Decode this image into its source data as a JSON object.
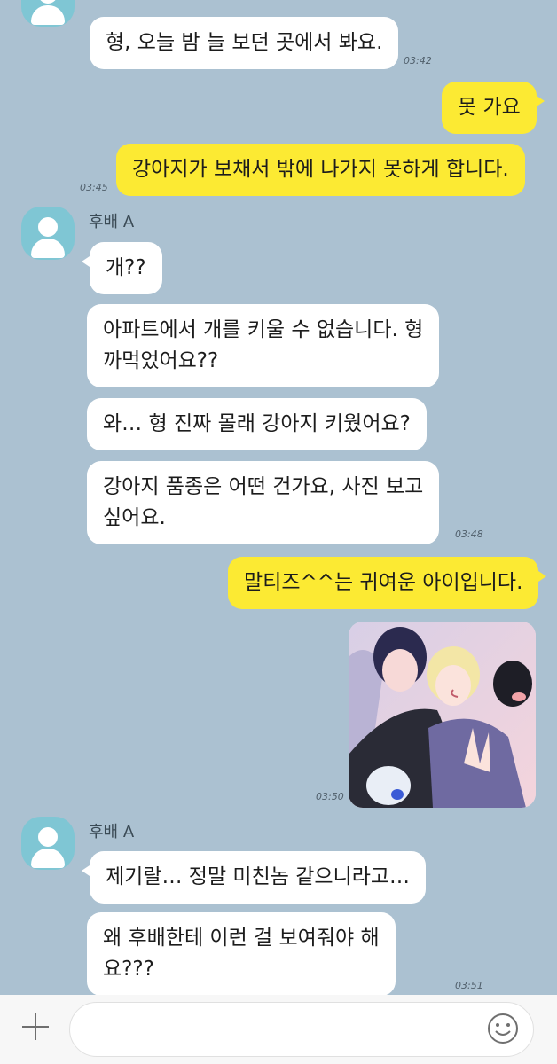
{
  "chat": {
    "sender_name": "후배 A",
    "messages": [
      {
        "from": "them",
        "text": "형, 오늘 밤 늘 보던 곳에서 봐요."
      },
      {
        "time": "03:42"
      },
      {
        "from": "me",
        "text": "못 가요"
      },
      {
        "from": "me",
        "text": "강아지가 보채서 밖에 나가지 못하게 합니다."
      },
      {
        "time": "03:45"
      },
      {
        "from": "them",
        "text": "개??"
      },
      {
        "from": "them",
        "text": "아파트에서 개를 키울 수 없습니다. 형\n까먹었어요??"
      },
      {
        "from": "them",
        "text": "와… 형 진짜 몰래 강아지 키웠어요?"
      },
      {
        "from": "them",
        "text": "강아지 품종은 어떤 건가요, 사진 보고\n싶어요."
      },
      {
        "time": "03:48"
      },
      {
        "from": "me",
        "text": "말티즈^^는 귀여운 아이입니다."
      },
      {
        "from": "me",
        "type": "photo"
      },
      {
        "time": "03:50"
      },
      {
        "from": "them",
        "text": "제기랄… 정말 미친놈 같으니라고…"
      },
      {
        "from": "them",
        "text": "왜 후배한테 이런 걸 보여줘야 해\n요???"
      },
      {
        "time": "03:51"
      }
    ]
  },
  "input": {
    "value": "",
    "placeholder": ""
  },
  "icons": {
    "add": "plus-icon",
    "emoji": "emoji-icon",
    "avatar": "avatar-icon"
  },
  "colors": {
    "background": "#abc1d1",
    "outgoing_bubble": "#fcea33",
    "incoming_bubble": "#ffffff",
    "avatar": "#7fc6d4"
  }
}
